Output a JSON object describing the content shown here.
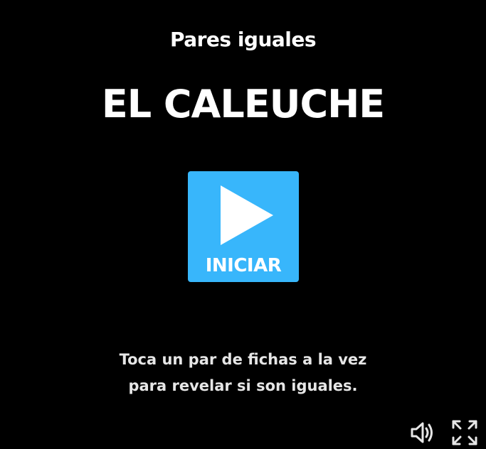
{
  "game": {
    "type_label": "Pares iguales",
    "title": "EL CALEUCHE"
  },
  "start_button": {
    "label": "INICIAR",
    "icon": "play-icon",
    "color": "#38b6fb"
  },
  "instructions": {
    "line1": "Toca un par de fichas a la vez",
    "line2": "para revelar si son iguales."
  },
  "controls": {
    "sound_icon": "speaker-icon",
    "fullscreen_icon": "fullscreen-icon"
  },
  "colors": {
    "background": "#000000",
    "text": "#ffffff",
    "accent": "#38b6fb"
  }
}
